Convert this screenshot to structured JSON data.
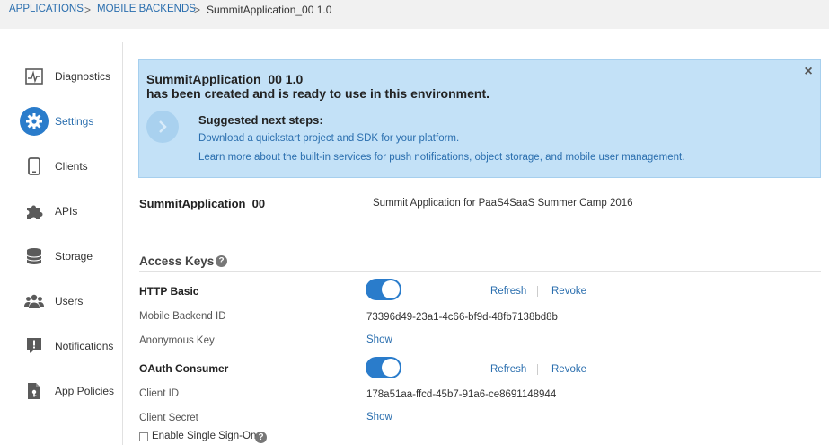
{
  "breadcrumb": {
    "items": [
      "APPLICATIONS",
      "MOBILE BACKENDS",
      "SummitApplication_00  1.0"
    ],
    "separator": ">"
  },
  "sidebar": {
    "items": [
      {
        "label": "Diagnostics",
        "icon": "diagnostics-icon",
        "active": false
      },
      {
        "label": "Settings",
        "icon": "gear-icon",
        "active": true
      },
      {
        "label": "Clients",
        "icon": "phone-icon",
        "active": false
      },
      {
        "label": "APIs",
        "icon": "puzzle-icon",
        "active": false
      },
      {
        "label": "Storage",
        "icon": "database-icon",
        "active": false
      },
      {
        "label": "Users",
        "icon": "users-icon",
        "active": false
      },
      {
        "label": "Notifications",
        "icon": "notification-icon",
        "active": false
      },
      {
        "label": "App Policies",
        "icon": "policy-icon",
        "active": false
      }
    ]
  },
  "banner": {
    "title_line1": "SummitApplication_00 1.0",
    "title_line2": "has been created and is ready to use in this environment.",
    "steps_title": "Suggested next steps:",
    "link1": "Download a quickstart project and SDK for your platform.",
    "link2": "Learn more about the built-in services for push notifications, object storage, and mobile user management.",
    "close": "×"
  },
  "app": {
    "name": "SummitApplication_00",
    "description": "Summit Application for PaaS4SaaS Summer Camp 2016"
  },
  "access_keys": {
    "title": "Access Keys",
    "help": "?",
    "http_basic": {
      "label": "HTTP Basic",
      "enabled": true,
      "refresh": "Refresh",
      "revoke": "Revoke",
      "backend_id_label": "Mobile Backend ID",
      "backend_id": "73396d49-23a1-4c66-bf9d-48fb7138bd8b",
      "anon_key_label": "Anonymous Key",
      "anon_key_action": "Show"
    },
    "oauth": {
      "label": "OAuth Consumer",
      "enabled": true,
      "refresh": "Refresh",
      "revoke": "Revoke",
      "client_id_label": "Client ID",
      "client_id": "178a51aa-ffcd-45b7-91a6-ce8691148944",
      "client_secret_label": "Client Secret",
      "client_secret_action": "Show"
    },
    "sso_label": "Enable Single Sign-On",
    "sso_checked": false
  },
  "colors": {
    "accent": "#2a7ccb",
    "link": "#2a6eae",
    "banner_bg": "#c3e1f7"
  }
}
